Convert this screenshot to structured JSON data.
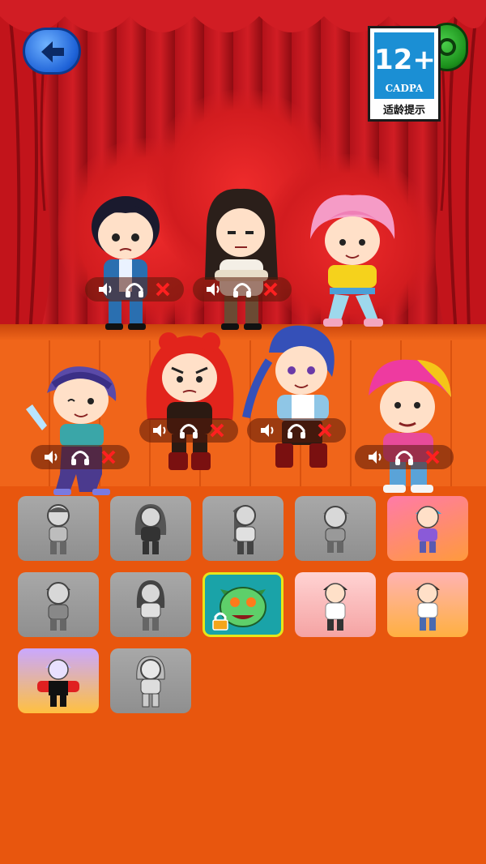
{
  "header": {
    "back_icon": "back-arrow-icon",
    "settings_icon": "green-round-icon"
  },
  "age_rating": {
    "number": "12+",
    "org": "CADPA",
    "label": "适龄提示"
  },
  "stage": {
    "performers": [
      {
        "name": "boy-blue-suit",
        "controls": [
          "speaker-icon",
          "headphones-icon",
          "remove-icon"
        ]
      },
      {
        "name": "girl-long-hair",
        "controls": [
          "speaker-icon",
          "headphones-icon",
          "remove-icon"
        ]
      },
      {
        "name": "pink-hair-boy",
        "controls": []
      },
      {
        "name": "purple-hair-girl",
        "controls": [
          "speaker-icon",
          "headphones-icon",
          "remove-icon"
        ]
      },
      {
        "name": "red-hair-girl",
        "controls": [
          "speaker-icon",
          "headphones-icon",
          "remove-icon"
        ]
      },
      {
        "name": "blue-braid-girl",
        "controls": [
          "speaker-icon",
          "headphones-icon",
          "remove-icon"
        ]
      },
      {
        "name": "pink-yellow-hair-boy",
        "controls": [
          "speaker-icon",
          "headphones-icon",
          "remove-icon"
        ]
      }
    ]
  },
  "tray": {
    "cards": [
      {
        "state": "used",
        "style": "gray"
      },
      {
        "state": "used",
        "style": "gray"
      },
      {
        "state": "used",
        "style": "gray"
      },
      {
        "state": "used",
        "style": "gray"
      },
      {
        "state": "available",
        "style": "pinkorange"
      },
      {
        "state": "used",
        "style": "gray"
      },
      {
        "state": "used",
        "style": "gray"
      },
      {
        "state": "locked",
        "style": "monster"
      },
      {
        "state": "available",
        "style": "pink"
      },
      {
        "state": "available",
        "style": "orange"
      },
      {
        "state": "available",
        "style": "purple"
      },
      {
        "state": "used",
        "style": "gray"
      }
    ]
  },
  "colors": {
    "floor": "#f0651a",
    "curtain": "#d11d24",
    "back_button": "#1f63d8",
    "badge_blue": "#1b8fd4"
  }
}
